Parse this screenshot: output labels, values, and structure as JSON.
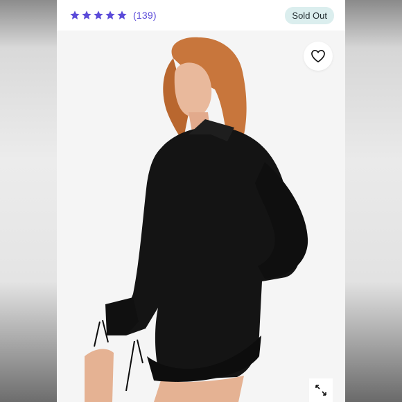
{
  "product": {
    "rating_stars": 5,
    "review_count": "(139)",
    "status_badge": "Sold Out"
  },
  "icons": {
    "star": "star-icon",
    "favorite": "heart-icon",
    "expand": "expand-icon"
  },
  "colors": {
    "accent": "#5b4bd9",
    "badge_bg": "#dbeeee",
    "garment": "#141414"
  }
}
